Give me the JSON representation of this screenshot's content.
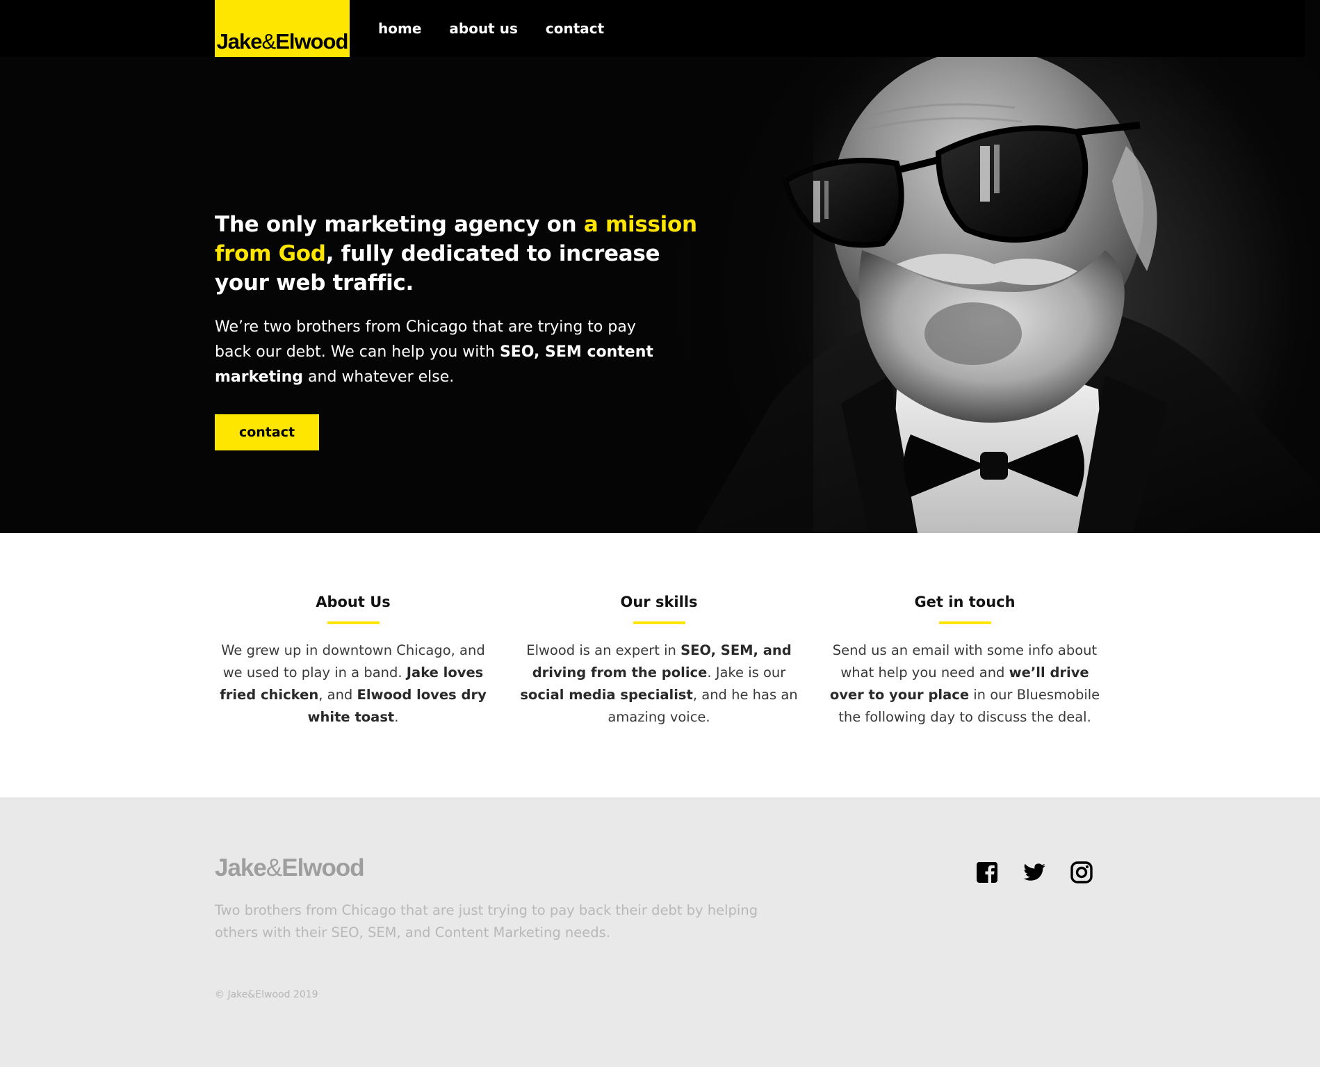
{
  "brand": {
    "name_left": "Jake",
    "name_amp": "&",
    "name_right": "Elwood",
    "accent_color": "#ffe600"
  },
  "nav": {
    "items": [
      {
        "label": "home"
      },
      {
        "label": "about us"
      },
      {
        "label": "contact"
      }
    ]
  },
  "hero": {
    "headline_part1": "The only marketing agency on ",
    "headline_highlight": "a mission from God",
    "headline_part2": ", fully dedicated to increase your web traffic.",
    "body_part1": "We’re two brothers from Chicago that are trying to pay back our debt. We can help you with ",
    "body_bold": "SEO, SEM content marketing",
    "body_part2": " and whatever else.",
    "cta_label": "contact",
    "image_icon": "portrait-photo"
  },
  "features": [
    {
      "title": "About Us",
      "text_1": "We grew up in downtown Chicago, and we used to play in a band. ",
      "bold_1": "Jake loves fried chicken",
      "text_2": ", and ",
      "bold_2": "Elwood loves dry white toast",
      "text_3": "."
    },
    {
      "title": "Our skills",
      "text_1": "Elwood is an expert in ",
      "bold_1": "SEO, SEM, and driving from the police",
      "text_2": ". Jake is our ",
      "bold_2": "social media specialist",
      "text_3": ", and he has an amazing voice."
    },
    {
      "title": "Get in touch",
      "text_1": "Send us an email with some info about what help you need and ",
      "bold_1": "we’ll drive over to your place",
      "text_2": " in our Bluesmobile the following day to discuss the deal.",
      "bold_2": "",
      "text_3": ""
    }
  ],
  "footer": {
    "logo_left": "Jake",
    "logo_amp": "&",
    "logo_right": "Elwood",
    "description": "Two brothers from Chicago that are just trying to pay back their debt by helping others with their SEO, SEM, and Content Marketing needs.",
    "copyright": "© Jake&Elwood 2019",
    "social": [
      {
        "icon": "facebook-icon"
      },
      {
        "icon": "twitter-icon"
      },
      {
        "icon": "instagram-icon"
      }
    ]
  }
}
